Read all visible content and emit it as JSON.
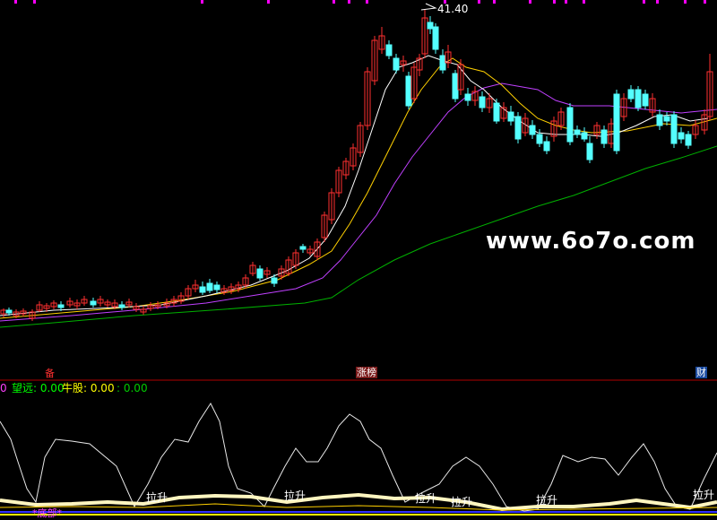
{
  "price_panel": {
    "high_label": "41.40",
    "watermark": "www.6o7o.com",
    "markers": {
      "left": "备",
      "middle": "涨榜",
      "right": "财"
    }
  },
  "indicator_panel": {
    "zero": "0",
    "legend": [
      {
        "label": "望远: 0.00",
        "color": "#00ff00"
      },
      {
        "label": "牛股: 0.00",
        "color": "#ffff00"
      },
      {
        "label": ": 0.00",
        "color": "#00cc00"
      }
    ],
    "signals": [
      "拉升",
      "拉升",
      "拉升",
      "拉升",
      "拉升",
      "拉升"
    ],
    "bottom_label": "*底部*"
  },
  "colors": {
    "up_candle": "#ff3030",
    "down_candle": "#54ffff",
    "ma_white": "#ffffff",
    "ma_yellow": "#ffd000",
    "ma_purple": "#c040ff",
    "ma_green": "#00b000",
    "separator": "#b00000"
  },
  "chart_data": {
    "type": "candlestick",
    "high_marker": 41.4,
    "series_names": []
  }
}
